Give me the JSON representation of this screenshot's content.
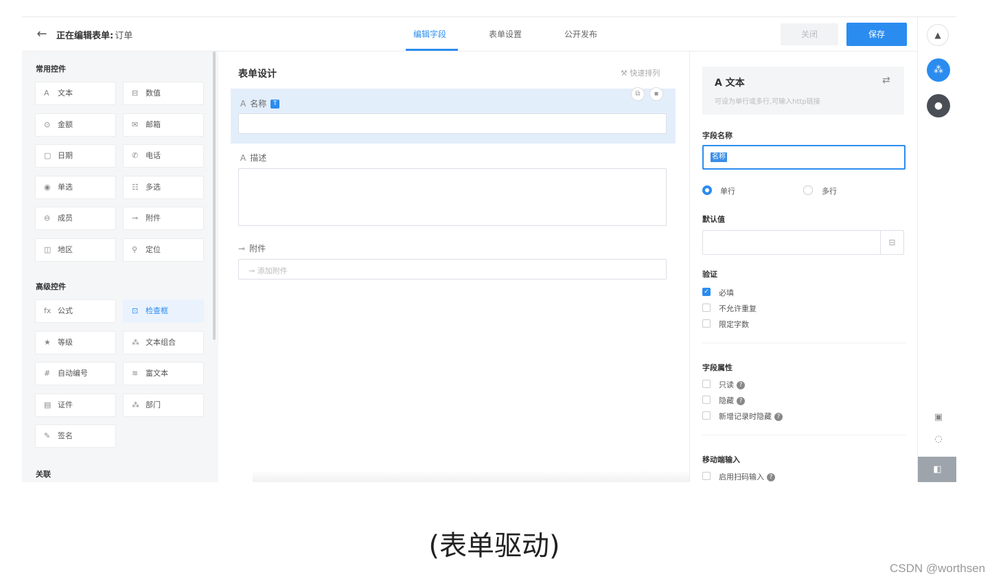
{
  "header": {
    "editing_prefix": "正在编辑表单:",
    "form_name": "订单",
    "tabs": [
      {
        "label": "编辑字段",
        "active": true
      },
      {
        "label": "表单设置",
        "active": false
      },
      {
        "label": "公开发布",
        "active": false
      }
    ],
    "close_label": "关闭",
    "save_label": "保存"
  },
  "palette": {
    "common_title": "常用控件",
    "common": [
      {
        "icon": "A",
        "label": "文本"
      },
      {
        "icon": "⊟",
        "label": "数值"
      },
      {
        "icon": "⊙",
        "label": "金额"
      },
      {
        "icon": "✉",
        "label": "邮箱"
      },
      {
        "icon": "▢",
        "label": "日期"
      },
      {
        "icon": "✆",
        "label": "电话"
      },
      {
        "icon": "◉",
        "label": "单选"
      },
      {
        "icon": "☷",
        "label": "多选"
      },
      {
        "icon": "⊖",
        "label": "成员"
      },
      {
        "icon": "⊸",
        "label": "附件"
      },
      {
        "icon": "◫",
        "label": "地区"
      },
      {
        "icon": "⚲",
        "label": "定位"
      }
    ],
    "advanced_title": "高级控件",
    "advanced": [
      {
        "icon": "fx",
        "label": "公式"
      },
      {
        "icon": "⊡",
        "label": "检查框",
        "highlight": true
      },
      {
        "icon": "★",
        "label": "等级"
      },
      {
        "icon": "⁂",
        "label": "文本组合"
      },
      {
        "icon": "#",
        "label": "自动编号"
      },
      {
        "icon": "≋",
        "label": "富文本"
      },
      {
        "icon": "▤",
        "label": "证件"
      },
      {
        "icon": "⁂",
        "label": "部门"
      },
      {
        "icon": "✎",
        "label": "签名"
      }
    ],
    "relation_title": "关联"
  },
  "design": {
    "title": "表单设计",
    "quick_sort": "快速排列",
    "fields": {
      "name_label": "名称",
      "desc_label": "描述",
      "attach_label": "附件",
      "attach_placeholder": "添加附件"
    }
  },
  "properties": {
    "type_title": "文本",
    "type_desc": "可设为单行或多行,可输入http链接",
    "field_name_label": "字段名称",
    "field_name_value": "名称",
    "single_line": "单行",
    "multi_line": "多行",
    "default_label": "默认值",
    "validation_label": "验证",
    "required": "必填",
    "no_duplicate": "不允许重复",
    "limit_chars": "限定字数",
    "attributes_label": "字段属性",
    "readonly": "只读",
    "hidden": "隐藏",
    "hide_on_new": "新增记录时隐藏",
    "mobile_label": "移动端输入",
    "scan_input": "启用扫码输入"
  },
  "caption": "(表单驱动)",
  "watermark": "CSDN @worthsen",
  "colors": {
    "accent": "#2b8cf0",
    "palette_bg": "#f5f6f8",
    "selected_field_bg": "#e3eefb"
  }
}
